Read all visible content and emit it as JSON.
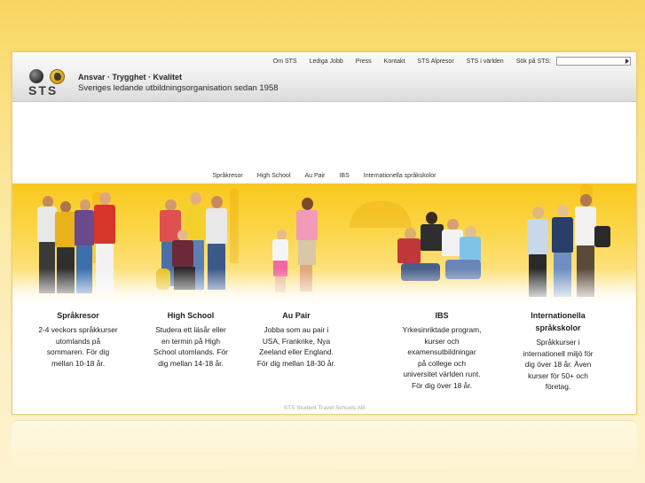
{
  "topnav": {
    "items": [
      "Om STS",
      "Lediga Jobb",
      "Press",
      "Kontakt",
      "STS Alpresor",
      "STS i världen"
    ],
    "search_label": "Sök på STS:",
    "search_value": ""
  },
  "brand": {
    "logo_text": "STS",
    "tagline_1": "Ansvar · Trygghet · Kvalitet",
    "tagline_2": "Sveriges ledande utbildningsorganisation sedan 1958"
  },
  "mainnav": {
    "items": [
      "Språkresor",
      "High School",
      "Au Pair",
      "IBS",
      "Internationella språkskolor"
    ]
  },
  "columns": [
    {
      "title": "Språkresor",
      "lines": [
        "2-4 veckors språkkurser",
        "utomlands på",
        "sommaren. För dig",
        "mellan 10-18 år."
      ]
    },
    {
      "title": "High School",
      "lines": [
        "Studera ett läsår eller",
        "en termin på High",
        "School utomlands. För",
        "dig mellan 14-18 år."
      ]
    },
    {
      "title": "Au Pair",
      "lines": [
        "Jobba som au pair i",
        "USA, Frankrike, Nya",
        "Zeeland eller England.",
        "För dig mellan 18-30 år."
      ]
    },
    {
      "title": "IBS",
      "lines": [
        "Yrkesinriktade program,",
        "kurser och",
        "examensutbildningar",
        "på college och",
        "universitet världen runt.",
        "För dig över 18 år."
      ]
    },
    {
      "title_lines": [
        "Internationella",
        "språkskolor"
      ],
      "lines": [
        "Språkkurser i",
        "internationell miljö för",
        "dig över 18 år. Även",
        "kurser för 50+ och",
        "företag."
      ]
    }
  ],
  "footer": {
    "text": "STS Student Travel Schools AB"
  },
  "colors": {
    "accent_yellow": "#f9c81d",
    "header_gray": "#dcdcdc",
    "text": "#222222"
  }
}
